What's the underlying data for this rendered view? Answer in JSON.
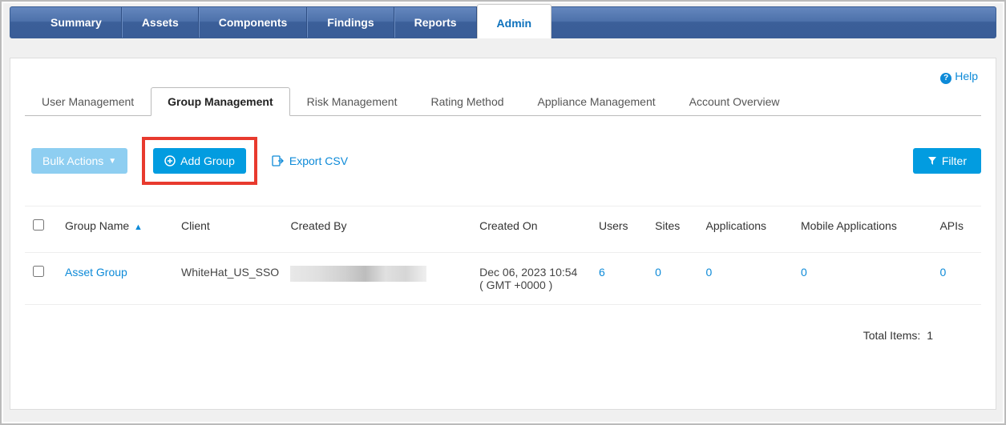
{
  "topnav": {
    "items": [
      {
        "label": "Summary"
      },
      {
        "label": "Assets"
      },
      {
        "label": "Components"
      },
      {
        "label": "Findings"
      },
      {
        "label": "Reports"
      },
      {
        "label": "Admin"
      }
    ],
    "activeIndex": 5
  },
  "help": {
    "label": "Help"
  },
  "subtabs": {
    "items": [
      {
        "label": "User Management"
      },
      {
        "label": "Group Management"
      },
      {
        "label": "Risk Management"
      },
      {
        "label": "Rating Method"
      },
      {
        "label": "Appliance Management"
      },
      {
        "label": "Account Overview"
      }
    ],
    "activeIndex": 1
  },
  "toolbar": {
    "bulk_label": "Bulk Actions",
    "add_group_label": "Add Group",
    "export_label": "Export CSV",
    "filter_label": "Filter"
  },
  "table": {
    "headers": {
      "group_name": "Group Name",
      "client": "Client",
      "created_by": "Created By",
      "created_on": "Created On",
      "users": "Users",
      "sites": "Sites",
      "applications": "Applications",
      "mobile_applications": "Mobile Applications",
      "apis": "APIs"
    },
    "rows": [
      {
        "group_name": "Asset Group",
        "client": "WhiteHat_US_SSO",
        "created_by": "",
        "created_on": "Dec 06, 2023 10:54 ( GMT +0000 )",
        "users": "6",
        "sites": "0",
        "applications": "0",
        "mobile_applications": "0",
        "apis": "0"
      }
    ]
  },
  "footer": {
    "total_label": "Total Items:",
    "total_value": "1"
  }
}
